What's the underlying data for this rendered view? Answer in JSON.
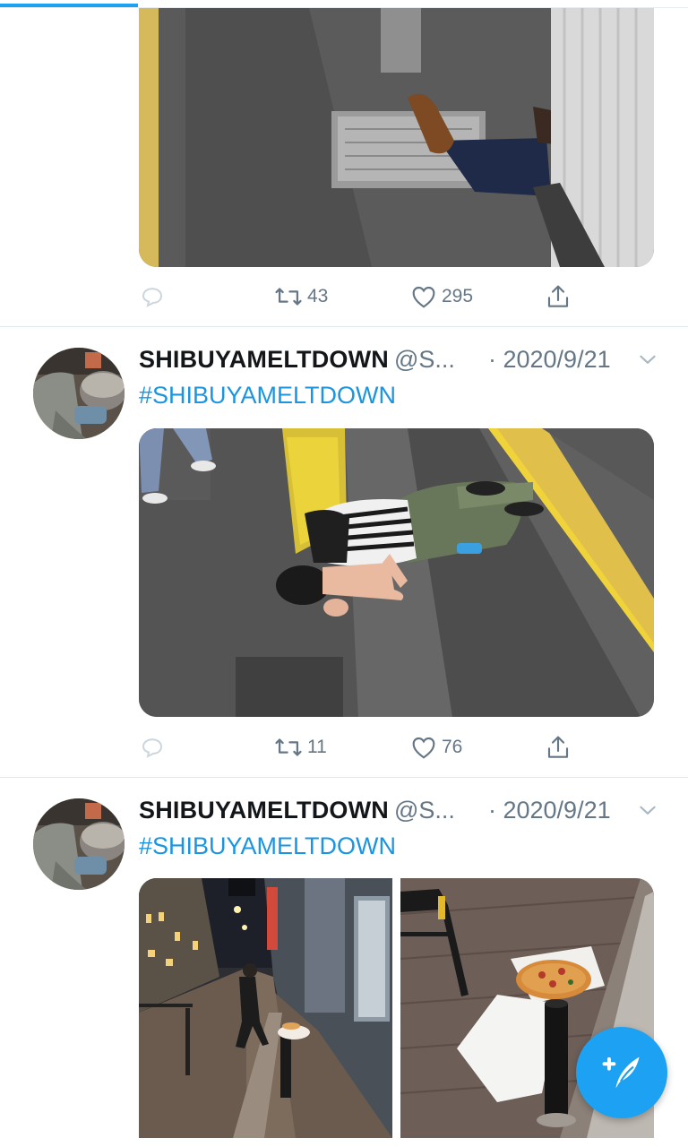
{
  "scroll_progress": 0.2,
  "tweets": [
    {
      "id": "tweet-top",
      "actions": {
        "retweets": "43",
        "likes": "295"
      }
    },
    {
      "id": "tweet-middle",
      "author": {
        "display_name": "SHIBUYAMELTDOWN",
        "handle": "@S...",
        "date": "· 2020/9/21"
      },
      "text": "#SHIBUYAMELTDOWN",
      "actions": {
        "retweets": "11",
        "likes": "76"
      }
    },
    {
      "id": "tweet-bottom",
      "author": {
        "display_name": "SHIBUYAMELTDOWN",
        "handle": "@S...",
        "date": "· 2020/9/21"
      },
      "text": "#SHIBUYAMELTDOWN"
    }
  ],
  "colors": {
    "accent": "#1da1f2",
    "hashtag": "#1b95e0",
    "secondary_text": "#657786",
    "tactile_paving": "#e8c64a"
  },
  "icons": [
    "reply-icon",
    "retweet-icon",
    "like-icon",
    "share-icon",
    "chevron-down-icon",
    "compose-tweet-icon"
  ]
}
